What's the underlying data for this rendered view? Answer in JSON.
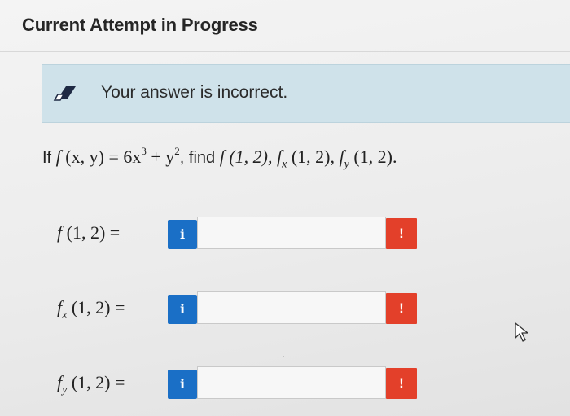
{
  "header": {
    "title": "Current Attempt in Progress"
  },
  "feedback": {
    "message": "Your answer is incorrect.",
    "icon": "pencil-eraser-icon"
  },
  "question": {
    "prefix": "If ",
    "f": "f",
    "args_xy": " (x, y) = 6x",
    "exp3": "3",
    "plus_y": " + y",
    "exp2": "2",
    "find_text": ", find ",
    "f_12": "f (1, 2), ",
    "fx_f": "f",
    "fx_sub": "x",
    "fx_args": " (1, 2), ",
    "fy_f": "f",
    "fy_sub": "y",
    "fy_args": " (1, 2)."
  },
  "answers": [
    {
      "label_f": "f",
      "label_sub": "",
      "label_args": " (1, 2) =",
      "info": "i",
      "value": "",
      "warning": "!"
    },
    {
      "label_f": "f",
      "label_sub": "x",
      "label_args": " (1, 2) =",
      "info": "i",
      "value": "",
      "warning": "!"
    },
    {
      "label_f": "f",
      "label_sub": "y",
      "label_args": " (1, 2) =",
      "info": "i",
      "value": "",
      "warning": "!"
    }
  ],
  "colors": {
    "info": "#1a6fc6",
    "warning": "#e3402a",
    "banner": "#cfe2ea"
  }
}
